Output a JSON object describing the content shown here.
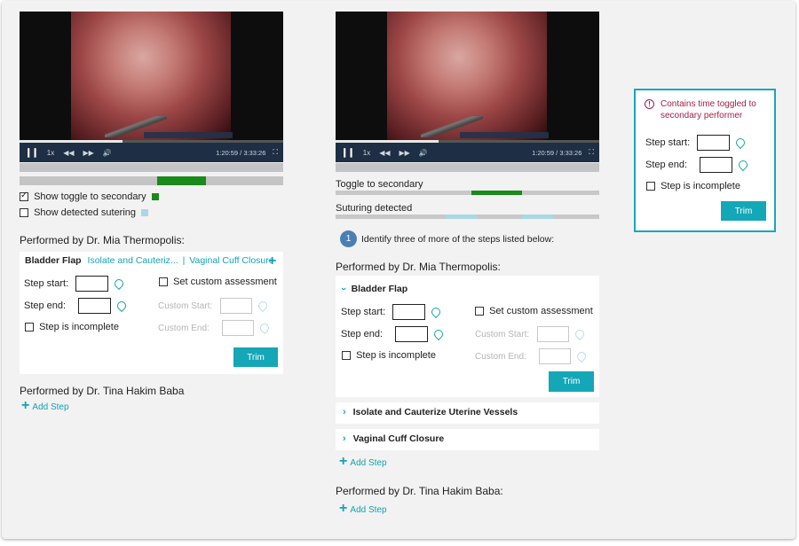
{
  "left": {
    "video": {
      "rate": "1x",
      "time": "1:20:59 / 3:33:26",
      "progress": 0.39
    },
    "toggle_label": "Show toggle to secondary",
    "suturing_label": "Show detected sutering",
    "performer1": "Performed by Dr. Mia Thermopolis:",
    "tabs": [
      "Bladder Flap",
      "Isolate and Cauteriz...",
      "|",
      "Vaginal Cuff Closure"
    ],
    "step_start": "Step start:",
    "step_end": "Step end:",
    "incomplete": "Step is incomplete",
    "custom_assessment": "Set custom assessment",
    "custom_start": "Custom Start:",
    "custom_end": "Custom End:",
    "trim": "Trim",
    "performer2": "Performed by Dr. Tina Hakim Baba",
    "add_step": "Add Step"
  },
  "middle": {
    "video": {
      "rate": "1x",
      "time": "1:20:59 / 3:33:26",
      "progress": 0.39
    },
    "toggle_label": "Toggle to secondary",
    "suturing_label": "Suturing detected",
    "step_number": "1",
    "instruction": "Identify three of more of the steps listed below:",
    "performer1": "Performed by Dr. Mia Thermopolis:",
    "step1_title": "Bladder Flap",
    "step_start": "Step start:",
    "step_end": "Step end:",
    "incomplete": "Step is incomplete",
    "custom_assessment": "Set custom assessment",
    "custom_start": "Custom Start:",
    "custom_end": "Custom End:",
    "trim": "Trim",
    "step2_title": "Isolate and Cauterize Uterine Vessels",
    "step3_title": "Vaginal Cuff Closure",
    "add_step": "Add Step",
    "performer2": "Performed by Dr. Tina Hakim Baba:",
    "add_step2": "Add Step"
  },
  "alert": {
    "message_line1": "Contains time toggled to",
    "message_line2": "secondary performer",
    "step_start": "Step start:",
    "step_end": "Step end:",
    "incomplete": "Step is incomplete",
    "trim": "Trim"
  },
  "colors": {
    "accent": "#14a7b8",
    "green": "#1a8a1a",
    "suturing": "#a9d8e2",
    "alert": "#a31f45"
  }
}
